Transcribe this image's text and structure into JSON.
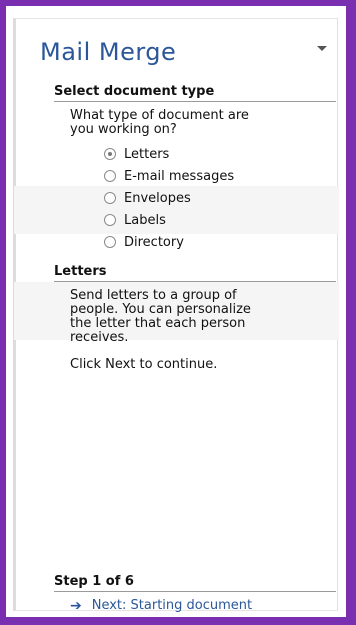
{
  "pane": {
    "title": "Mail Merge",
    "dropdown_icon": "chevron-down-icon"
  },
  "select_type": {
    "heading": "Select document type",
    "question_line1": "What type of document are",
    "question_line2": "you working on?",
    "options": [
      {
        "label": "Letters",
        "checked": true
      },
      {
        "label": "E-mail messages",
        "checked": false
      },
      {
        "label": "Envelopes",
        "checked": false
      },
      {
        "label": "Labels",
        "checked": false
      },
      {
        "label": "Directory",
        "checked": false
      }
    ]
  },
  "letters": {
    "heading": "Letters",
    "desc_line1": "Send letters to a group of",
    "desc_line2": "people. You can personalize",
    "desc_line3": "the letter that each person",
    "desc_line4": "receives.",
    "continue_text": "Click Next to continue."
  },
  "footer": {
    "step_text": "Step 1 of 6",
    "next_label": "Next: Starting document",
    "next_icon": "arrow-right-icon"
  },
  "colors": {
    "frame": "#7a2fb0",
    "title": "#2b579a",
    "link": "#2b579a"
  }
}
